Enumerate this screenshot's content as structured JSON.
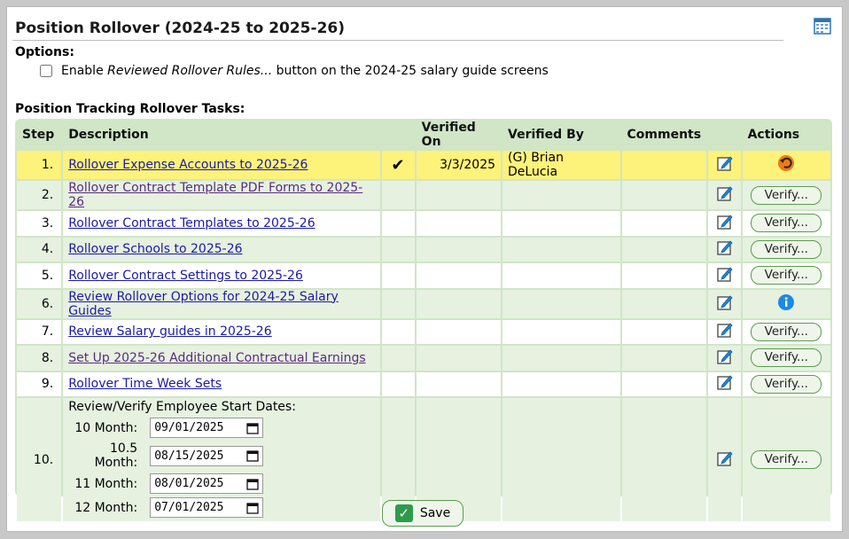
{
  "title": "Position Rollover (2024-25 to 2025-26)",
  "options": {
    "label": "Options:",
    "checkbox_prefix": "Enable ",
    "checkbox_italic": "Reviewed Rollover Rules...",
    "checkbox_suffix": " button on the 2024-25 salary guide screens",
    "checked": false
  },
  "tasks_label": "Position Tracking Rollover Tasks:",
  "columns": [
    "Step",
    "Description",
    "Verified On",
    "Verified By",
    "Comments",
    "Actions"
  ],
  "rows": [
    {
      "step": "1.",
      "desc": "Rollover Expense Accounts to 2025-26",
      "check": "✔",
      "verified_on": "3/3/2025",
      "verified_by": "(G) Brian DeLucia",
      "action": "undo"
    },
    {
      "step": "2.",
      "desc": "Rollover Contract Template PDF Forms to 2025-26",
      "action": "verify"
    },
    {
      "step": "3.",
      "desc": "Rollover Contract Templates to 2025-26",
      "action": "verify"
    },
    {
      "step": "4.",
      "desc": "Rollover Schools to 2025-26",
      "action": "verify"
    },
    {
      "step": "5.",
      "desc": "Rollover Contract Settings to 2025-26",
      "action": "verify"
    },
    {
      "step": "6.",
      "desc": "Review Rollover Options for 2024-25 Salary Guides",
      "action": "info"
    },
    {
      "step": "7.",
      "desc": "Review Salary guides in 2025-26",
      "action": "verify"
    },
    {
      "step": "8.",
      "desc": "Set Up 2025-26 Additional Contractual Earnings",
      "action": "verify"
    },
    {
      "step": "9.",
      "desc": "Rollover Time Week Sets",
      "action": "verify"
    }
  ],
  "row10": {
    "step": "10.",
    "heading": "Review/Verify Employee Start Dates:",
    "dates": [
      {
        "label": "10 Month:",
        "value": "09/01/2025"
      },
      {
        "label": "10.5 Month:",
        "value": "08/15/2025"
      },
      {
        "label": "11 Month:",
        "value": "08/01/2025"
      },
      {
        "label": "12 Month:",
        "value": "07/01/2025"
      }
    ]
  },
  "verify_label": "Verify...",
  "save_label": "Save"
}
